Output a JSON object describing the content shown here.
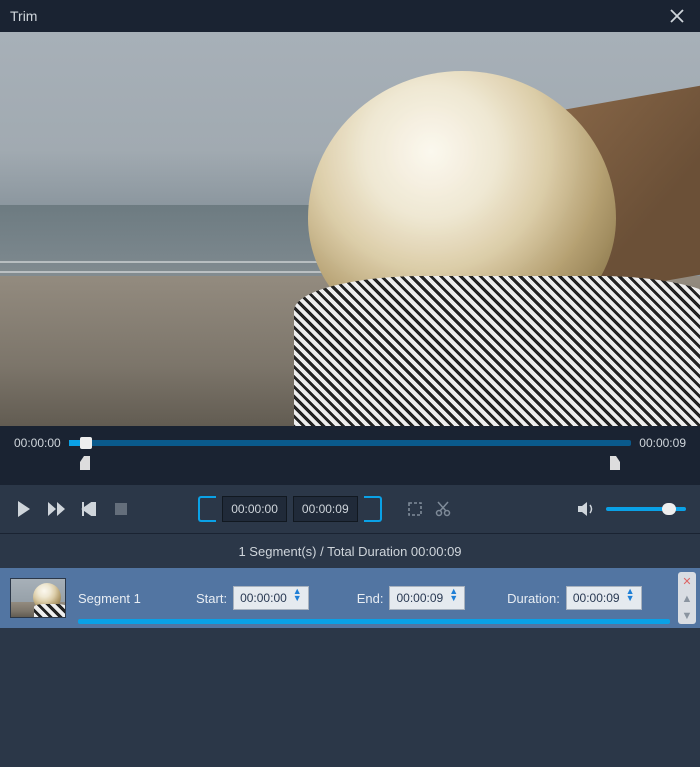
{
  "title": "Trim",
  "timeline": {
    "current": "00:00:00",
    "total": "00:00:09"
  },
  "bracket_start": "00:00:00",
  "bracket_end": "00:00:09",
  "summary": "1 Segment(s) / Total Duration 00:00:09",
  "segment": {
    "name": "Segment 1",
    "start_label": "Start:",
    "start": "00:00:00",
    "end_label": "End:",
    "end": "00:00:09",
    "duration_label": "Duration:",
    "duration": "00:00:09"
  },
  "colors": {
    "accent": "#0aa1e6",
    "panel": "#2b3748",
    "darker": "#1a2332",
    "segrow": "#5275a2"
  }
}
